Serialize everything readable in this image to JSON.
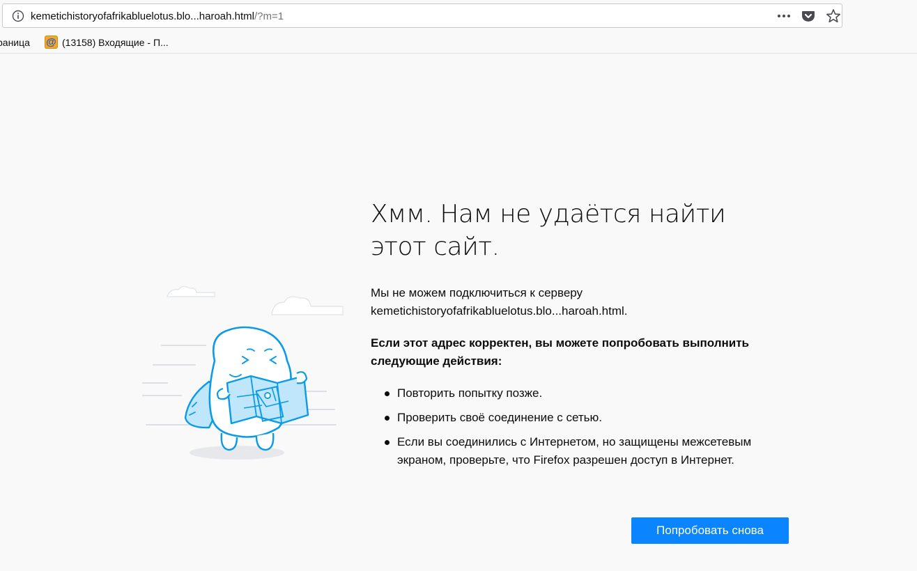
{
  "toolbar": {
    "url_host": "kemetichistoryofafrikabluelotus.blo...haroah.html",
    "url_rest": "/?m=1",
    "icons": [
      "info-icon",
      "page-actions-icon",
      "pocket-icon",
      "bookmark-star-icon"
    ]
  },
  "bookmarks": {
    "items": [
      {
        "label": "раница"
      },
      {
        "label": "(13158) Входящие - П...",
        "icon": "mail-icon"
      }
    ]
  },
  "error": {
    "title": "Хмм. Нам не удаётся найти этот сайт.",
    "description_line1": "Мы не можем подключиться к серверу",
    "description_line2": "kemetichistoryofafrikabluelotus.blo...haroah.html.",
    "suggestions_heading": "Если этот адрес корректен, вы можете попробовать выполнить следующие действия:",
    "suggestions": [
      "Повторить попытку позже.",
      "Проверить своё соединение с сетью.",
      "Если вы соединились с Интернетом, но защищены межсетевым экраном, проверьте, что Firefox разрешен доступ в Интернет."
    ],
    "retry_label": "Попробовать снова"
  },
  "colors": {
    "accent": "#0a84ff",
    "page_bg": "#f9f9fa",
    "illustration_stroke": "#0a9be6",
    "illustration_fill": "#bfe6fb"
  }
}
